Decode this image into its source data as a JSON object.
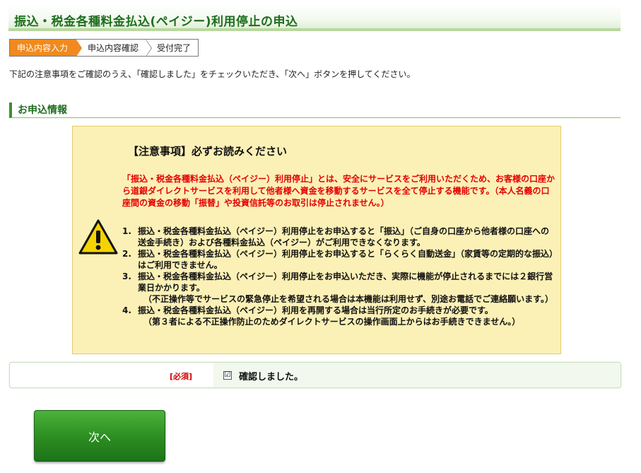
{
  "page_title": "振込・税金各種料金払込(ペイジー)利用停止の申込",
  "steps": [
    {
      "label": "申込内容入力",
      "active": true
    },
    {
      "label": "申込内容確認",
      "active": false
    },
    {
      "label": "受付完了",
      "active": false
    }
  ],
  "instruction": "下記の注意事項をご確認のうえ、「確認しました」をチェックいただき、「次へ」ボタンを押してください。",
  "section_heading": "お申込情報",
  "notice": {
    "title": "【注意事項】必ずお読みください",
    "red_text": "「振込・税金各種料金払込（ペイジー）利用停止」とは、安全にサービスをご利用いただくため、お客様の口座から道銀ダイレクトサービスを利用して他者様へ資金を移動するサービスを全て停止する機能です。（本人名義の口座間の資金の移動「振替」や投資信託等のお取引は停止されません。）",
    "items": [
      {
        "num": "1.",
        "text": "振込・税金各種料金払込（ペイジー）利用停止をお申込すると「振込」（ご自身の口座から他者様の口座への送金手続き）および各種料金払込（ペイジー）がご利用できなくなります。",
        "note": ""
      },
      {
        "num": "2.",
        "text": "振込・税金各種料金払込（ペイジー）利用停止をお申込すると「らくらく自動送金」（家賃等の定期的な振込）はご利用できません。",
        "note": ""
      },
      {
        "num": "3.",
        "text": "振込・税金各種料金払込（ペイジー）利用停止をお申込いただき、実際に機能が停止されるまでには２銀行営業日かかります。",
        "note": "（不正操作等でサービスの緊急停止を希望される場合は本機能は利用せず、別途お電話でご連絡願います。）"
      },
      {
        "num": "4.",
        "text": "振込・税金各種料金払込（ペイジー）利用を再開する場合は当行所定のお手続きが必要です。",
        "note": "（第３者による不正操作防止のためダイレクトサービスの操作画面上からはお手続きできません。）"
      }
    ]
  },
  "confirm": {
    "required_label": "[必須]",
    "checkbox_mark": "☑",
    "checked": true,
    "label": "確認しました。"
  },
  "next_button": "次へ",
  "colors": {
    "accent_green": "#2d8f22",
    "step_active": "#f08a1e",
    "notice_bg": "#fbf0b6",
    "warning_red": "#e60000"
  }
}
